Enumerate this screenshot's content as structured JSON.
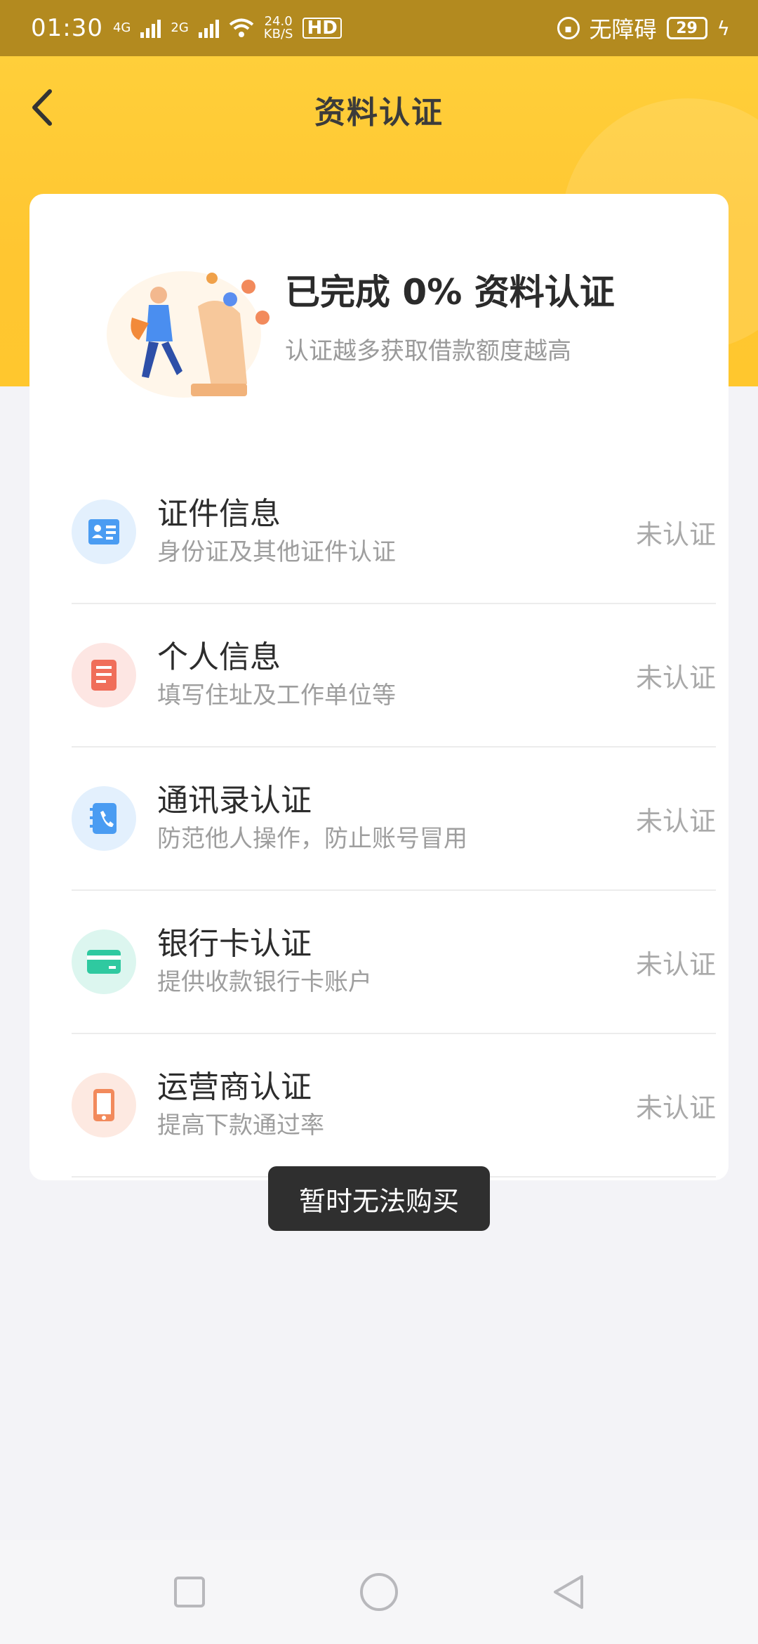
{
  "status_bar": {
    "time": "01:30",
    "net1": "4G",
    "net2": "2G",
    "speed_value": "24.0",
    "speed_unit": "KB/S",
    "hd": "HD",
    "accessibility": "无障碍",
    "battery": "29"
  },
  "header": {
    "title": "资料认证"
  },
  "summary": {
    "title": "已完成 0% 资料认证",
    "subtitle": "认证越多获取借款额度越高",
    "progress_percent": 0
  },
  "items": [
    {
      "title": "证件信息",
      "subtitle": "身份证及其他证件认证",
      "status": "未认证",
      "icon": "id-card-icon",
      "icon_bg": "#e3f0fd",
      "icon_color": "#4a9cf2"
    },
    {
      "title": "个人信息",
      "subtitle": "填写住址及工作单位等",
      "status": "未认证",
      "icon": "document-icon",
      "icon_bg": "#fde6e3",
      "icon_color": "#f06e5a"
    },
    {
      "title": "通讯录认证",
      "subtitle": "防范他人操作，防止账号冒用",
      "status": "未认证",
      "icon": "contacts-phone-icon",
      "icon_bg": "#e3f0fd",
      "icon_color": "#4a9cf2"
    },
    {
      "title": "银行卡认证",
      "subtitle": "提供收款银行卡账户",
      "status": "未认证",
      "icon": "bank-card-icon",
      "icon_bg": "#dcf6ef",
      "icon_color": "#2fc9a0"
    },
    {
      "title": "运营商认证",
      "subtitle": "提高下款通过率",
      "status": "未认证",
      "icon": "mobile-phone-icon",
      "icon_bg": "#fde9e1",
      "icon_color": "#f28a5c"
    }
  ],
  "toast": {
    "text": "暂时无法购买"
  },
  "colors": {
    "header": "#ffc631",
    "statusbar": "#b38a1f",
    "background": "#f3f3f7"
  }
}
